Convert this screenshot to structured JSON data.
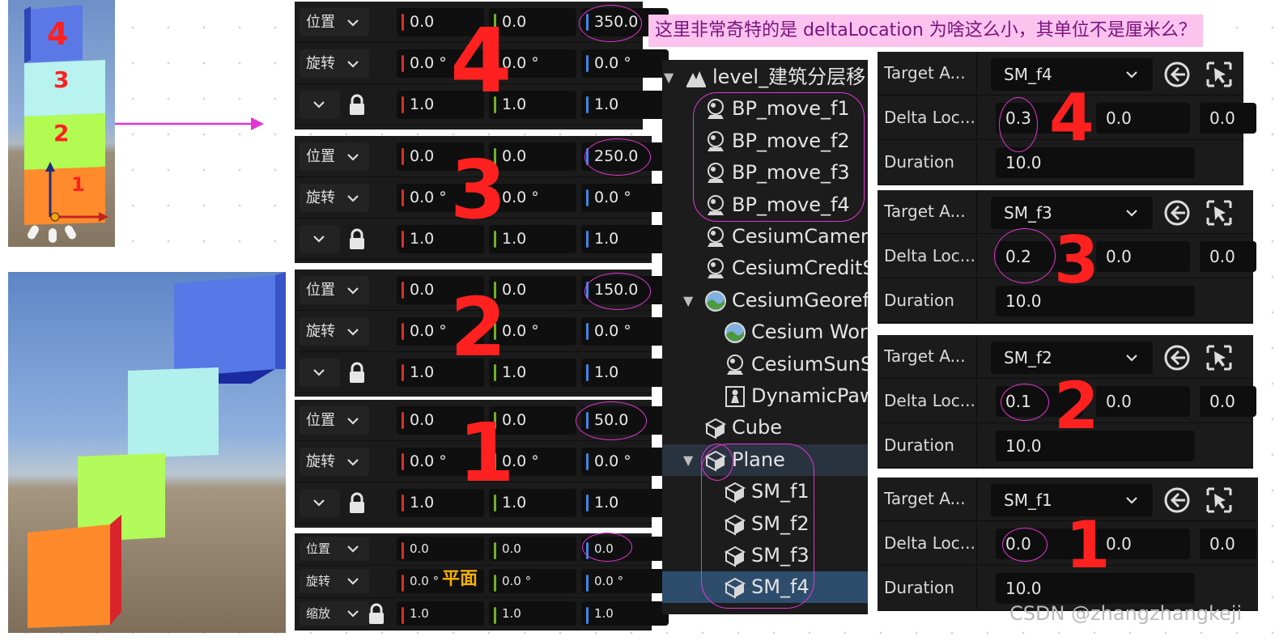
{
  "annotation": {
    "question": "这里非常奇特的是 deltaLocation 为啥这么小，其单位不是厘米么？",
    "plane_note": "平面",
    "watermark": "CSDN @zhangzhangkeji"
  },
  "viewport": {
    "stack_numbers": [
      "4",
      "3",
      "2",
      "1"
    ]
  },
  "transform_panels": [
    {
      "id": "f4",
      "annotation": "4",
      "rows": [
        {
          "label": "位置",
          "x": "0.0",
          "y": "0.0",
          "z": "350.0"
        },
        {
          "label": "旋转",
          "x": "0.0 °",
          "y": "0.0 °",
          "z": "0.0 °"
        },
        {
          "label": "",
          "x": "1.0",
          "y": "1.0",
          "z": "1.0"
        }
      ]
    },
    {
      "id": "f3",
      "annotation": "3",
      "rows": [
        {
          "label": "位置",
          "x": "0.0",
          "y": "0.0",
          "z": "250.0"
        },
        {
          "label": "旋转",
          "x": "0.0 °",
          "y": "0.0 °",
          "z": "0.0 °"
        },
        {
          "label": "",
          "x": "1.0",
          "y": "1.0",
          "z": "1.0"
        }
      ]
    },
    {
      "id": "f2",
      "annotation": "2",
      "rows": [
        {
          "label": "位置",
          "x": "0.0",
          "y": "0.0",
          "z": "150.0"
        },
        {
          "label": "旋转",
          "x": "0.0 °",
          "y": "0.0 °",
          "z": "0.0 °"
        },
        {
          "label": "",
          "x": "1.0",
          "y": "1.0",
          "z": "1.0"
        }
      ]
    },
    {
      "id": "f1",
      "annotation": "1",
      "rows": [
        {
          "label": "位置",
          "x": "0.0",
          "y": "0.0",
          "z": "50.0"
        },
        {
          "label": "旋转",
          "x": "0.0 °",
          "y": "0.0 °",
          "z": "0.0 °"
        },
        {
          "label": "",
          "x": "1.0",
          "y": "1.0",
          "z": "1.0"
        }
      ]
    },
    {
      "id": "plane",
      "annotation": "",
      "rows": [
        {
          "label": "位置",
          "x": "0.0",
          "y": "0.0",
          "z": "0.0"
        },
        {
          "label": "旋转",
          "x": "0.0 °",
          "y": "0.0 °",
          "z": "0.0 °"
        },
        {
          "label": "缩放",
          "x": "1.0",
          "y": "1.0",
          "z": "1.0"
        }
      ]
    }
  ],
  "outliner": {
    "items": [
      {
        "label": "level_建筑分层移",
        "icon": "level-icon",
        "expanded": true
      },
      {
        "label": "BP_move_f1",
        "icon": "actor-icon"
      },
      {
        "label": "BP_move_f2",
        "icon": "actor-icon"
      },
      {
        "label": "BP_move_f3",
        "icon": "actor-icon"
      },
      {
        "label": "BP_move_f4",
        "icon": "actor-icon"
      },
      {
        "label": "CesiumCamer",
        "icon": "actor-icon"
      },
      {
        "label": "CesiumCreditS",
        "icon": "actor-icon"
      },
      {
        "label": "CesiumGeoref",
        "icon": "globe-icon",
        "expanded": true
      },
      {
        "label": "Cesium Wor",
        "icon": "globe-icon"
      },
      {
        "label": "CesiumSunS",
        "icon": "actor-icon"
      },
      {
        "label": "DynamicPaw",
        "icon": "pawn-icon"
      },
      {
        "label": "Cube",
        "icon": "mesh-icon"
      },
      {
        "label": "Plane",
        "icon": "mesh-icon",
        "expanded": true
      },
      {
        "label": "SM_f1",
        "icon": "mesh-icon"
      },
      {
        "label": "SM_f2",
        "icon": "mesh-icon"
      },
      {
        "label": "SM_f3",
        "icon": "mesh-icon"
      },
      {
        "label": "SM_f4",
        "icon": "mesh-icon",
        "selected": true
      }
    ]
  },
  "details_panels": [
    {
      "id": "f4",
      "annotation": "4",
      "target_label": "Target A...",
      "target_value": "SM_f4",
      "delta_label": "Delta Loc...",
      "delta": [
        "0.3",
        "0.0",
        "0.0"
      ],
      "duration_label": "Duration",
      "duration": "10.0"
    },
    {
      "id": "f3",
      "annotation": "3",
      "target_label": "Target A...",
      "target_value": "SM_f3",
      "delta_label": "Delta Loc...",
      "delta": [
        "0.2",
        "0.0",
        "0.0"
      ],
      "duration_label": "Duration",
      "duration": "10.0"
    },
    {
      "id": "f2",
      "annotation": "2",
      "target_label": "Target A...",
      "target_value": "SM_f2",
      "delta_label": "Delta Loc...",
      "delta": [
        "0.1",
        "0.0",
        "0.0"
      ],
      "duration_label": "Duration",
      "duration": "10.0"
    },
    {
      "id": "f1",
      "annotation": "1",
      "target_label": "Target A...",
      "target_value": "SM_f1",
      "delta_label": "Delta Loc...",
      "delta": [
        "0.0",
        "0.0",
        "0.0"
      ],
      "duration_label": "Duration",
      "duration": "10.0"
    }
  ],
  "colors": {
    "axis_x": "#d63228",
    "axis_y": "#6fb02e",
    "axis_z": "#3f86e6",
    "highlight": "#e236d3",
    "handwriting": "#ff2020",
    "selection": "#2e4d6d",
    "cube_1": "#ff8a2e",
    "cube_2": "#b5ff5a",
    "cube_3": "#b4f2ee",
    "cube_4": "#5a7be6"
  }
}
